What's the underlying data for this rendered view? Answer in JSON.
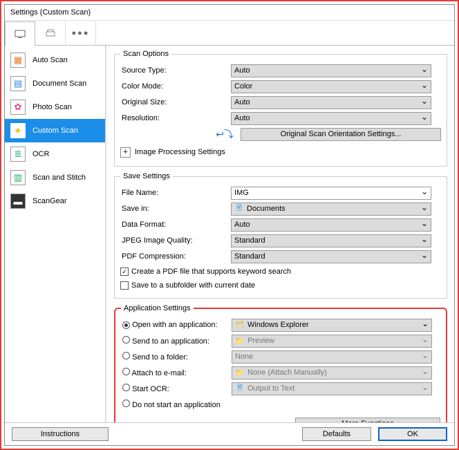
{
  "window_title": "Settings (Custom Scan)",
  "sidebar": {
    "items": [
      {
        "label": "Auto Scan"
      },
      {
        "label": "Document Scan"
      },
      {
        "label": "Photo Scan"
      },
      {
        "label": "Custom Scan"
      },
      {
        "label": "OCR"
      },
      {
        "label": "Scan and Stitch"
      },
      {
        "label": "ScanGear"
      }
    ]
  },
  "scan_options": {
    "legend": "Scan Options",
    "source_type": {
      "label": "Source Type:",
      "value": "Auto"
    },
    "color_mode": {
      "label": "Color Mode:",
      "value": "Color"
    },
    "original_size": {
      "label": "Original Size:",
      "value": "Auto"
    },
    "resolution": {
      "label": "Resolution:",
      "value": "Auto"
    },
    "orientation_btn": "Original Scan Orientation Settings...",
    "img_proc": "Image Processing Settings"
  },
  "save_settings": {
    "legend": "Save Settings",
    "file_name": {
      "label": "File Name:",
      "value": "IMG"
    },
    "save_in": {
      "label": "Save in:",
      "value": "Documents"
    },
    "data_format": {
      "label": "Data Format:",
      "value": "Auto"
    },
    "jpeg_quality": {
      "label": "JPEG Image Quality:",
      "value": "Standard"
    },
    "pdf_compression": {
      "label": "PDF Compression:",
      "value": "Standard"
    },
    "chk_pdf": "Create a PDF file that supports keyword search",
    "chk_subfolder": "Save to a subfolder with current date"
  },
  "app_settings": {
    "legend": "Application Settings",
    "open_app": {
      "label": "Open with an application:",
      "value": "Windows Explorer"
    },
    "send_app": {
      "label": "Send to an application:",
      "value": "Preview"
    },
    "send_folder": {
      "label": "Send to a folder:",
      "value": "None"
    },
    "attach_email": {
      "label": "Attach to e-mail:",
      "value": "None (Attach Manually)"
    },
    "start_ocr": {
      "label": "Start OCR:",
      "value": "Output to Text"
    },
    "no_app": "Do not start an application",
    "more_functions": "More Functions"
  },
  "footer": {
    "instructions": "Instructions",
    "defaults": "Defaults",
    "ok": "OK"
  }
}
